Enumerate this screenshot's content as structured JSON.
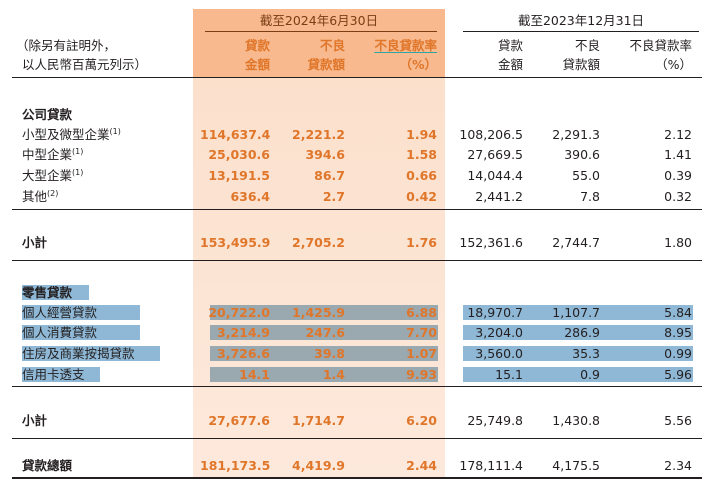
{
  "header": {
    "unit_note_line1": "（除另有註明外，",
    "unit_note_line2": "以人民幣百萬元列示）",
    "period_current": "截至2024年6月30日",
    "period_prior": "截至2023年12月31日",
    "col_loan_1": "貸款",
    "col_loan_2": "金額",
    "col_npl_1": "不良",
    "col_npl_2": "貸款額",
    "col_ratio_1": "不良貸款率",
    "col_ratio_2": "（%）"
  },
  "sections": {
    "corporate_title": "公司貸款",
    "retail_title": "零售貸款"
  },
  "corporate_rows": [
    {
      "label": "小型及微型企業",
      "note": "(1)",
      "cur": [
        "114,637.4",
        "2,221.2",
        "1.94"
      ],
      "prev": [
        "108,206.5",
        "2,291.3",
        "2.12"
      ]
    },
    {
      "label": "中型企業",
      "note": "(1)",
      "cur": [
        "25,030.6",
        "394.6",
        "1.58"
      ],
      "prev": [
        "27,669.5",
        "390.6",
        "1.41"
      ]
    },
    {
      "label": "大型企業",
      "note": "(1)",
      "cur": [
        "13,191.5",
        "86.7",
        "0.66"
      ],
      "prev": [
        "14,044.4",
        "55.0",
        "0.39"
      ]
    },
    {
      "label": "其他",
      "note": "(2)",
      "cur": [
        "636.4",
        "2.7",
        "0.42"
      ],
      "prev": [
        "2,441.2",
        "7.8",
        "0.32"
      ]
    }
  ],
  "corporate_subtotal": {
    "label": "小計",
    "cur": [
      "153,495.9",
      "2,705.2",
      "1.76"
    ],
    "prev": [
      "152,361.6",
      "2,744.7",
      "1.80"
    ]
  },
  "retail_rows": [
    {
      "label": "個人經營貸款",
      "cur": [
        "20,722.0",
        "1,425.9",
        "6.88"
      ],
      "prev": [
        "18,970.7",
        "1,107.7",
        "5.84"
      ]
    },
    {
      "label": "個人消費貸款",
      "cur": [
        "3,214.9",
        "247.6",
        "7.70"
      ],
      "prev": [
        "3,204.0",
        "286.9",
        "8.95"
      ]
    },
    {
      "label": "住房及商業按揭貸款",
      "cur": [
        "3,726.6",
        "39.8",
        "1.07"
      ],
      "prev": [
        "3,560.0",
        "35.3",
        "0.99"
      ]
    },
    {
      "label": "信用卡透支",
      "cur": [
        "14.1",
        "1.4",
        "9.93"
      ],
      "prev": [
        "15.1",
        "0.9",
        "5.96"
      ]
    }
  ],
  "retail_subtotal": {
    "label": "小計",
    "cur": [
      "27,677.6",
      "1,714.7",
      "6.20"
    ],
    "prev": [
      "25,749.8",
      "1,430.8",
      "5.56"
    ]
  },
  "total": {
    "label": "貸款總額",
    "cur": [
      "181,173.5",
      "4,419.9",
      "2.44"
    ],
    "prev": [
      "178,111.4",
      "4,175.5",
      "2.34"
    ]
  },
  "colors": {
    "accent": "#e0762a",
    "band": "#fbe0cc",
    "band_header": "#f7b98d",
    "highlight": "#8fb8d6"
  }
}
